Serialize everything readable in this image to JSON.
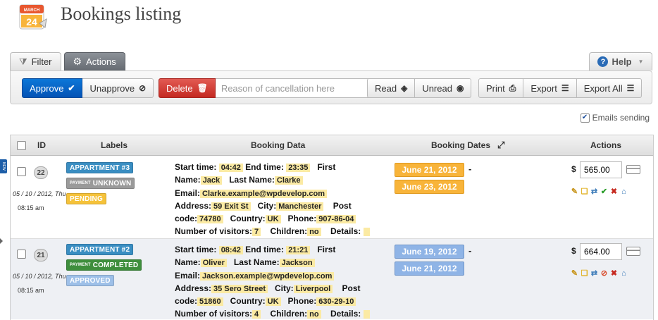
{
  "header": {
    "title": "Bookings listing",
    "icon": "calendar-icon",
    "calendar_month": "MARCH",
    "calendar_day": "24"
  },
  "tabs": [
    {
      "label": "Filter",
      "icon": "filter-icon",
      "active": false
    },
    {
      "label": "Actions",
      "icon": "gears-icon",
      "active": true
    }
  ],
  "help": {
    "label": "Help"
  },
  "toolbar": {
    "approve": "Approve",
    "unapprove": "Unapprove",
    "delete": "Delete",
    "reason_placeholder": "Reason of cancellation here",
    "read": "Read",
    "unread": "Unread",
    "print": "Print",
    "export": "Export",
    "export_all": "Export All"
  },
  "emails_sending": {
    "label": "Emails sending",
    "checked": true
  },
  "table": {
    "headers": {
      "id": "ID",
      "labels": "Labels",
      "booking_data": "Booking Data",
      "booking_dates": "Booking Dates",
      "actions": "Actions"
    },
    "rows": [
      {
        "id": "22",
        "date": "05 / 10 / 2012, Thu",
        "time": "08:15 am",
        "labels": {
          "resource": "APPARTMENT #3",
          "payment_prefix": "PAYMENT",
          "payment": "UNKNOWN",
          "status": "PENDING"
        },
        "fields": {
          "start_time_label": "Start time:",
          "start_time": "04:42",
          "end_time_label": "End time:",
          "end_time": "23:35",
          "first_label": "First",
          "name_label": "Name:",
          "name": "Jack",
          "last_name_label": "Last Name:",
          "last_name": "Clarke",
          "email_label": "Email:",
          "email": "Clarke.example@wpdevelop.com",
          "address_label": "Address:",
          "address": "59 Exit St",
          "city_label": "City:",
          "city": "Manchester",
          "post_label": "Post",
          "code_label": "code:",
          "code": "74780",
          "country_label": "Country:",
          "country": "UK",
          "phone_label": "Phone:",
          "phone": "907-86-04",
          "visitors_label": "Number of visitors:",
          "visitors": "7",
          "children_label": "Children:",
          "children": "no",
          "details_label": "Details:"
        },
        "dates": [
          "June 21, 2012",
          "June 23, 2012"
        ],
        "currency": "$",
        "cost": "565.00"
      },
      {
        "id": "21",
        "date": "05 / 10 / 2012, Thu",
        "time": "08:15 am",
        "labels": {
          "resource": "APPARTMENT #2",
          "payment_prefix": "PAYMENT",
          "payment": "COMPLETED",
          "status": "APPROVED"
        },
        "fields": {
          "start_time_label": "Start time:",
          "start_time": "08:42",
          "end_time_label": "End time:",
          "end_time": "21:21",
          "first_label": "First",
          "name_label": "Name:",
          "name": "Oliver",
          "last_name_label": "Last Name:",
          "last_name": "Jackson",
          "email_label": "Email:",
          "email": "Jackson.example@wpdevelop.com",
          "address_label": "Address:",
          "address": "35 Sero Street",
          "city_label": "City:",
          "city": "Liverpool",
          "post_label": "Post",
          "code_label": "code:",
          "code": "51860",
          "country_label": "Country:",
          "country": "UK",
          "phone_label": "Phone:",
          "phone": "630-29-10",
          "visitors_label": "Number of visitors:",
          "visitors": "4",
          "children_label": "Children:",
          "children": "no",
          "details_label": "Details:"
        },
        "dates": [
          "June 19, 2012",
          "June 21, 2012"
        ],
        "currency": "$",
        "cost": "664.00"
      }
    ]
  },
  "new_badge": "NEW"
}
